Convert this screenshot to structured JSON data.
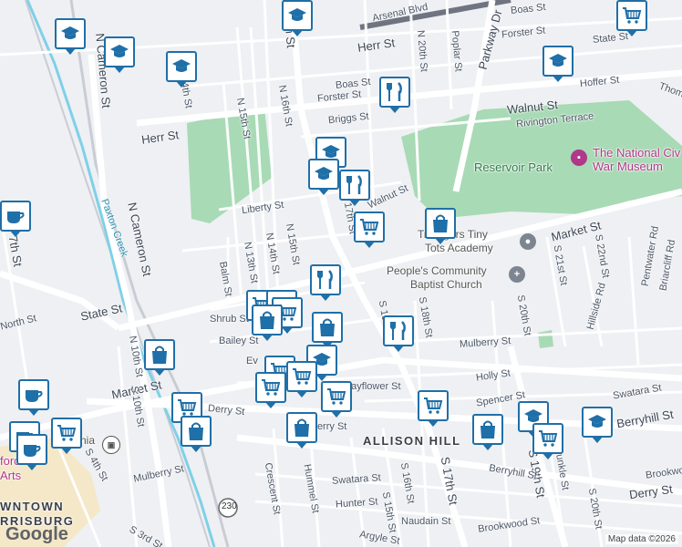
{
  "map": {
    "streets": {
      "arsenal_blvd": "Arsenal Blvd",
      "boas_st_ne": "Boas St",
      "forster_st_ne": "Forster St",
      "state_st_ne": "State St",
      "hoffer_st": "Hoffer St",
      "thomas": "Thomas",
      "herr_st_top": "Herr St",
      "n_17th_st_top": "N 17th St",
      "n_20th_st": "N 20th St",
      "poplar_st": "Poplar St",
      "parkway_dr": "Parkway Dr",
      "n_cameron_st_top": "N Cameron St",
      "n_14th_st": "N 14th St",
      "boas_st": "Boas St",
      "forster_st": "Forster St",
      "walnut_st": "Walnut St",
      "rivington_terrace": "Rivington Terrace",
      "n_15th_st": "N 15th St",
      "n_16th_st": "N 16th St",
      "briggs_st": "Briggs St",
      "herr_st": "Herr St",
      "n_cameron_st": "N Cameron St",
      "liberty_st": "Liberty St",
      "walnut_st_2": "Walnut St",
      "market_st_ne": "Market St",
      "paxton_creek": "Paxton Creek",
      "s_17th_st_left": "S 17th St",
      "n_15th_st_2": "N 15th St",
      "n_14th_st_2": "N 14th St",
      "n_13th_st": "N 13th St",
      "balm_st": "Balm St",
      "state_st": "State St",
      "north_st": "North St",
      "shrub_st": "Shrub St",
      "bailey_st": "Bailey St",
      "s_22nd_st": "S 22nd St",
      "s_21st_st": "S 21st St",
      "pentwater_rd": "Pentwater Rd",
      "briarcliff_rd": "Briarcliff Rd",
      "hillside_rd": "Hillside Rd",
      "s_18th_st": "S 18th St",
      "s_20th_st": "S 20th St",
      "mulberry_st_e": "Mulberry St",
      "holly_st": "Holly St",
      "mayflower_st": "Mayflower St",
      "spencer_st": "Spencer St",
      "swatara_st_e": "Swatara St",
      "berryhill_st_e": "Berryhill St",
      "market_st": "Market St",
      "s_10th_st": "S 10th St",
      "n_10th_st": "N 10th St",
      "derry_st_mid": "Derry St",
      "derry_st_w": "Derry St",
      "derry_st_e": "Derry St",
      "evergreen": "Ev",
      "mulberry_st_w": "Mulberry St",
      "s_4th_st": "S 4th St",
      "crescent_st": "Crescent St",
      "hummel_st": "Hummel St",
      "swatara_st": "Swatara St",
      "hunter_st": "Hunter St",
      "s_15th_st": "S 15th St",
      "s_16th_st": "S 16th St",
      "s_17th_st": "S 17th St",
      "s_19th_st": "S 19th St",
      "dunkle_st": "Dunkle St",
      "s_20th_st_2": "S 20th St",
      "berryhill_st": "Berryhill St",
      "brookwood_st": "Brookwood St",
      "brookwood_st_e": "Brookwood",
      "naudain_st": "Naudain St",
      "argyle_st": "Argyle St",
      "s_3rd_st": "S 3rd St",
      "route_230": "230",
      "n_7th_st": "7th St",
      "s_19th_label_top": "S 19th St",
      "n_17th_mid": "N 17th St"
    },
    "places": {
      "reservoir_park": "Reservoir Park",
      "museum_line1": "The National Civ",
      "museum_line2": "War Museum",
      "academy_line1": "Tr  Angers Tiny",
      "academy_line2": "Tots Academy",
      "church_line1": "People's Community",
      "church_line2": "Baptist Church",
      "allison_hill": "ALLISON HILL",
      "downtown_line1": "WNTOWN",
      "downtown_line2": "RRISBURG",
      "pennsylvania": "nia",
      "arts_line1": "forc",
      "arts_line2": "Arts"
    },
    "attribution": "Map data ©2026",
    "logo": "Google"
  }
}
